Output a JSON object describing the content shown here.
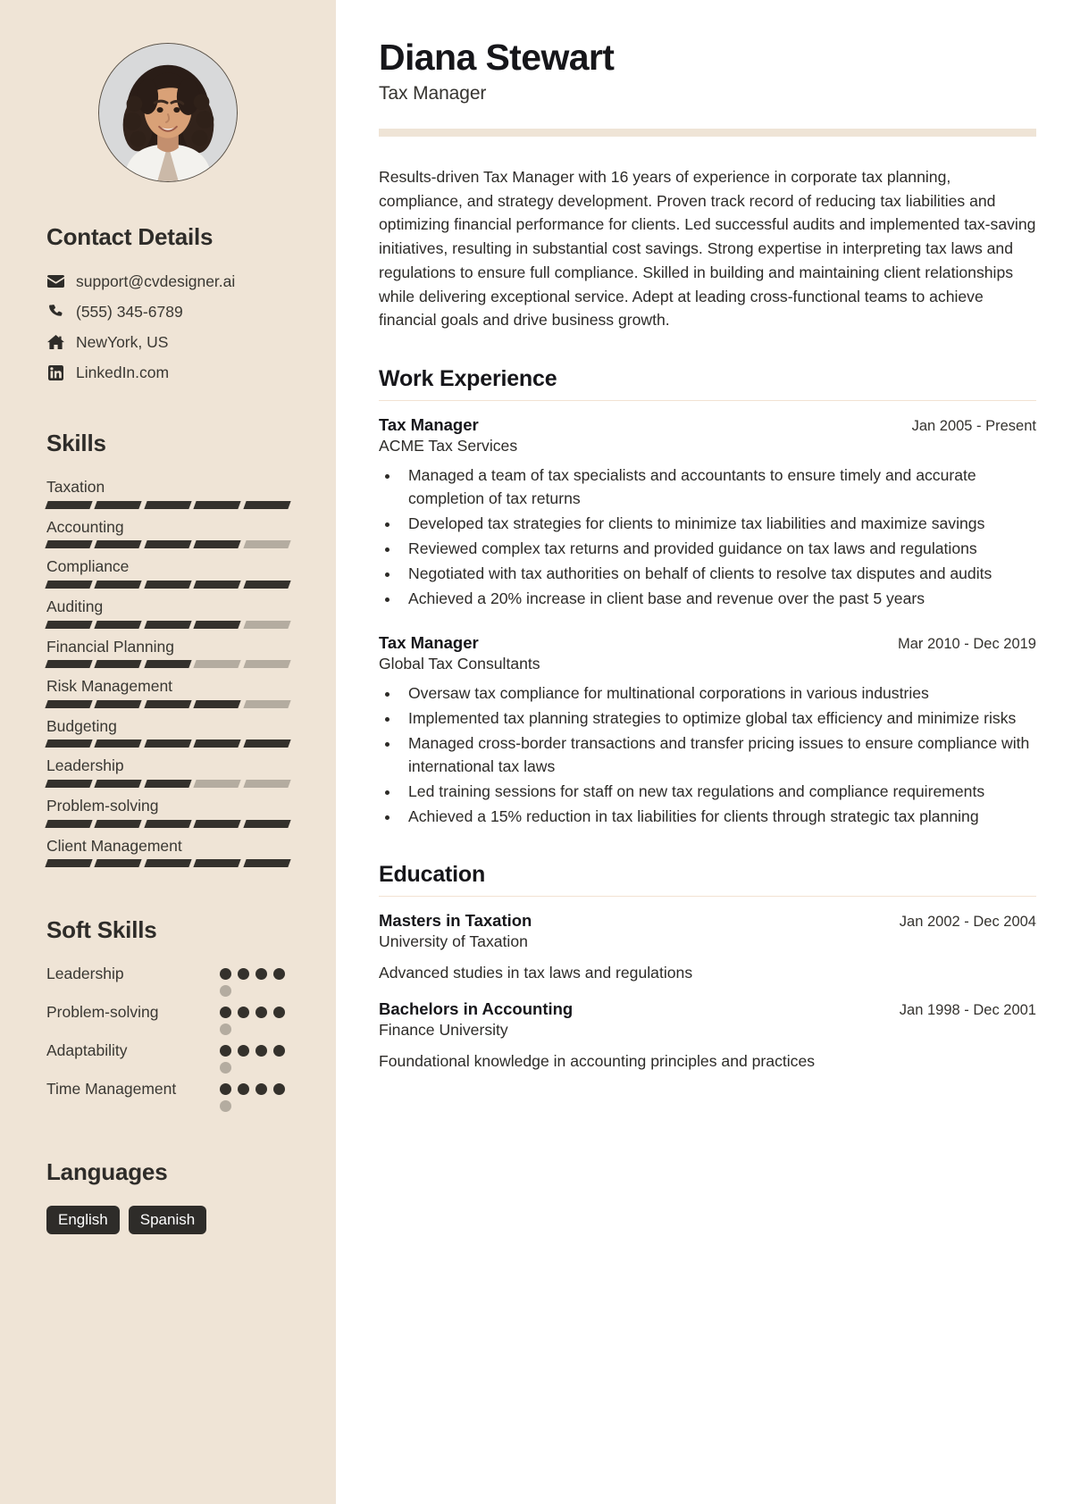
{
  "theme": {
    "sidebar_bg": "#efe4d6",
    "accent_bar": "#efe4d6",
    "ink": "#2e2c29",
    "bar_filled": "#34312c",
    "bar_empty": "#b4aca0",
    "tag_bg": "#2e2c29",
    "tag_text": "#ffffff"
  },
  "header": {
    "name": "Diana Stewart",
    "role": "Tax Manager"
  },
  "summary": "Results-driven Tax Manager with 16 years of experience in corporate tax planning, compliance, and strategy development. Proven track record of reducing tax liabilities and optimizing financial performance for clients. Led successful audits and implemented tax-saving initiatives, resulting in substantial cost savings. Strong expertise in interpreting tax laws and regulations to ensure full compliance. Skilled in building and maintaining client relationships while delivering exceptional service. Adept at leading cross-functional teams to achieve financial goals and drive business growth.",
  "sidebar": {
    "contact": {
      "heading": "Contact Details",
      "items": [
        {
          "icon": "envelope-icon",
          "value": "support@cvdesigner.ai"
        },
        {
          "icon": "phone-icon",
          "value": "(555) 345-6789"
        },
        {
          "icon": "home-icon",
          "value": "NewYork, US"
        },
        {
          "icon": "linkedin-icon",
          "value": "LinkedIn.com"
        }
      ]
    },
    "skills": {
      "heading": "Skills",
      "max": 5,
      "items": [
        {
          "name": "Taxation",
          "level": 5
        },
        {
          "name": "Accounting",
          "level": 4
        },
        {
          "name": "Compliance",
          "level": 5
        },
        {
          "name": "Auditing",
          "level": 4
        },
        {
          "name": "Financial Planning",
          "level": 3
        },
        {
          "name": "Risk Management",
          "level": 4
        },
        {
          "name": "Budgeting",
          "level": 5
        },
        {
          "name": "Leadership",
          "level": 3
        },
        {
          "name": "Problem-solving",
          "level": 5
        },
        {
          "name": "Client Management",
          "level": 5
        }
      ]
    },
    "soft_skills": {
      "heading": "Soft Skills",
      "max": 5,
      "items": [
        {
          "name": "Leadership",
          "level": 4
        },
        {
          "name": "Problem-solving",
          "level": 4
        },
        {
          "name": "Adaptability",
          "level": 4
        },
        {
          "name": "Time Management",
          "level": 4
        }
      ]
    },
    "languages": {
      "heading": "Languages",
      "items": [
        "English",
        "Spanish"
      ]
    }
  },
  "work": {
    "heading": "Work Experience",
    "entries": [
      {
        "title": "Tax Manager",
        "date": "Jan 2005 - Present",
        "org": "ACME Tax Services",
        "bullets": [
          "Managed a team of tax specialists and accountants to ensure timely and accurate completion of tax returns",
          "Developed tax strategies for clients to minimize tax liabilities and maximize savings",
          "Reviewed complex tax returns and provided guidance on tax laws and regulations",
          "Negotiated with tax authorities on behalf of clients to resolve tax disputes and audits",
          "Achieved a 20% increase in client base and revenue over the past 5 years"
        ]
      },
      {
        "title": "Tax Manager",
        "date": "Mar 2010 - Dec 2019",
        "org": "Global Tax Consultants",
        "bullets": [
          "Oversaw tax compliance for multinational corporations in various industries",
          "Implemented tax planning strategies to optimize global tax efficiency and minimize risks",
          "Managed cross-border transactions and transfer pricing issues to ensure compliance with international tax laws",
          "Led training sessions for staff on new tax regulations and compliance requirements",
          "Achieved a 15% reduction in tax liabilities for clients through strategic tax planning"
        ]
      }
    ]
  },
  "education": {
    "heading": "Education",
    "entries": [
      {
        "title": "Masters in Taxation",
        "date": "Jan 2002 - Dec 2004",
        "org": "University of Taxation",
        "desc": "Advanced studies in tax laws and regulations"
      },
      {
        "title": "Bachelors in Accounting",
        "date": "Jan 1998 - Dec 2001",
        "org": "Finance University",
        "desc": "Foundational knowledge in accounting principles and practices"
      }
    ]
  }
}
